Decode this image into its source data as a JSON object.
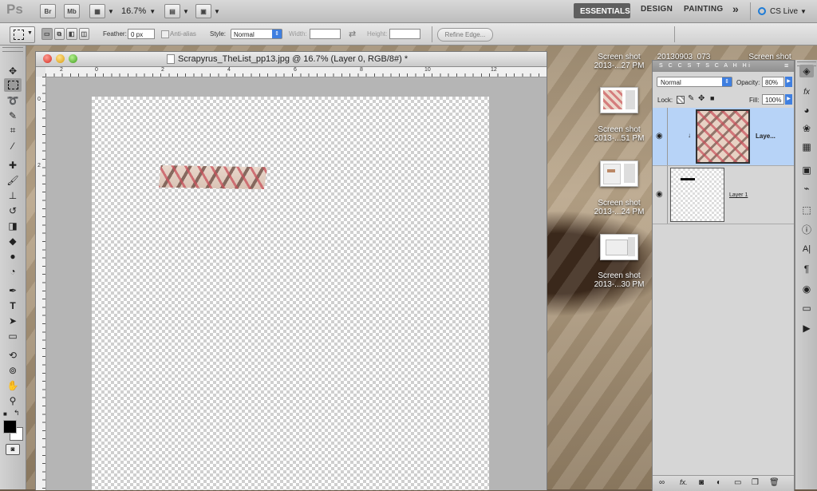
{
  "app": {
    "logo": "Ps",
    "bridge": "Br",
    "minibridge": "Mb",
    "zoom": "16.7%",
    "workspaces": [
      "ESSENTIALS",
      "DESIGN",
      "PAINTING"
    ],
    "more": "»",
    "cslive": "CS Live"
  },
  "options": {
    "feather_label": "Feather:",
    "feather_value": "0 px",
    "antialias_label": "Anti-alias",
    "style_label": "Style:",
    "style_value": "Normal",
    "width_label": "Width:",
    "height_label": "Height:",
    "refine_edge": "Refine Edge..."
  },
  "document": {
    "title": "Scrapyrus_TheList_pp13.jpg @ 16.7% (Layer 0, RGB/8#) *",
    "ruler_h": [
      "2",
      "0",
      "2",
      "4",
      "6",
      "8",
      "10",
      "12"
    ],
    "ruler_v": [
      "0",
      "2"
    ]
  },
  "desktop": {
    "items": [
      {
        "line1": "Screen shot",
        "line2": "2013-...27 PM"
      },
      {
        "line1": "20130903_073",
        "line2": ""
      },
      {
        "line1": "Screen shot",
        "line2": ""
      },
      {
        "line1": "Screen shot",
        "line2": "2013-...51 PM"
      },
      {
        "line1": "Screen shot",
        "line2": "2013-...24 PM"
      },
      {
        "line1": "Screen shot",
        "line2": "2013-...30 PM"
      }
    ],
    "partial_right": [
      "ot",
      "PM",
      "051"
    ]
  },
  "layers": {
    "tabs": "S C C S T S C A H Hi",
    "blend_mode": "Normal",
    "opacity_label": "Opacity:",
    "opacity_value": "80%",
    "lock_label": "Lock:",
    "fill_label": "Fill:",
    "fill_value": "100%",
    "items": [
      {
        "name": "Laye...",
        "selected": true
      },
      {
        "name": "Layer 1",
        "selected": false
      }
    ]
  },
  "colors": {
    "selection": "#b7d3f7",
    "accent": "#1e7bd6"
  }
}
